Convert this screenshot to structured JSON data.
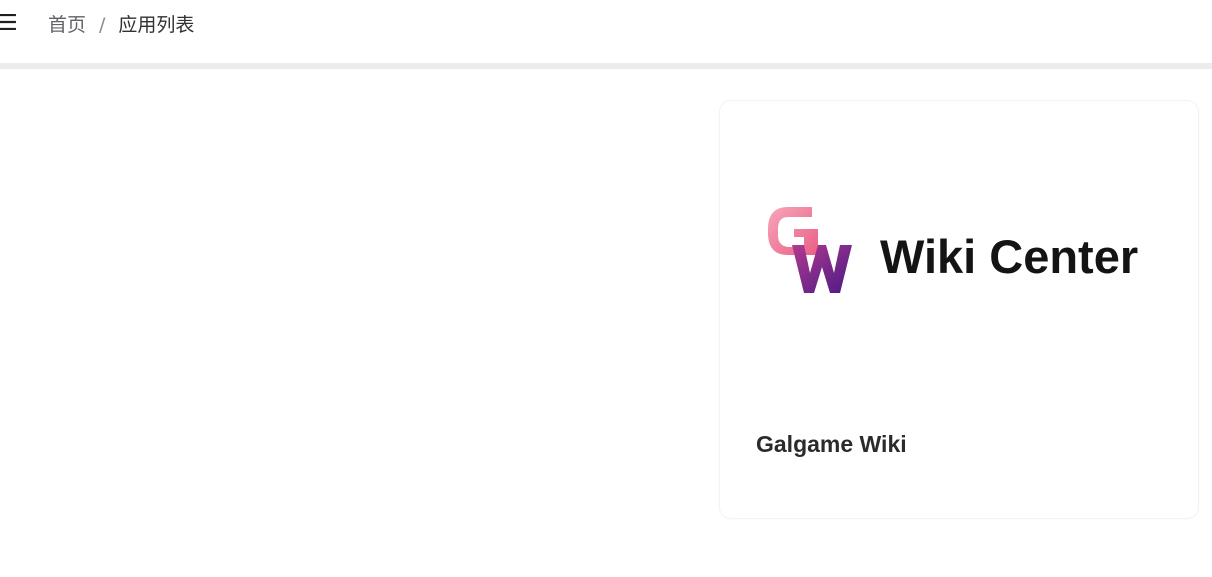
{
  "header": {
    "menu_icon": "menu-icon",
    "breadcrumb": {
      "home": "首页",
      "separator": "/",
      "current": "应用列表"
    }
  },
  "apps": [
    {
      "name": "Galgame Wiki",
      "logo": {
        "text": "Wiki Center",
        "mark_letters": "GW",
        "colors": {
          "pink": "#f06a8e",
          "purple": "#5a1e8c"
        }
      }
    }
  ],
  "colors": {
    "text": "#1f1f1f",
    "muted": "#606266",
    "divider": "#ececec"
  }
}
